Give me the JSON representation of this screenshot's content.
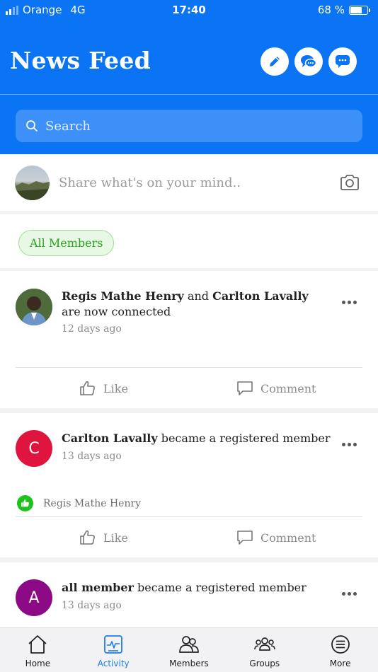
{
  "status_bar": {
    "carrier": "Orange",
    "network": "4G",
    "time": "17:40",
    "battery": "68 %"
  },
  "header": {
    "title": "News Feed",
    "buttons": [
      "edit-icon",
      "chat-bubbles-icon",
      "message-icon"
    ]
  },
  "search": {
    "placeholder": "Search"
  },
  "composer": {
    "placeholder": "Share what's on your mind.."
  },
  "filter": {
    "label": "All Members"
  },
  "posts": [
    {
      "actor": "Regis Mathe Henry",
      "joiner": "and",
      "actor2": "Carlton Lavally",
      "text": "are now connected",
      "time": "12 days ago",
      "avatar_letter": "",
      "avatar_color": "#3c5a2e",
      "like_label": "Like",
      "comment_label": "Comment"
    },
    {
      "actor": "Carlton Lavally",
      "text": "became a registered member",
      "time": "13 days ago",
      "avatar_letter": "C",
      "avatar_color": "#e0153e",
      "liked_by": "Regis Mathe Henry",
      "like_label": "Like",
      "comment_label": "Comment"
    },
    {
      "actor": "all member",
      "text": "became a registered member",
      "time": "13 days ago",
      "avatar_letter": "A",
      "avatar_color": "#8c0a85"
    }
  ],
  "tabs": [
    {
      "label": "Home",
      "icon": "home-icon"
    },
    {
      "label": "Activity",
      "icon": "activity-icon",
      "active": true
    },
    {
      "label": "Members",
      "icon": "members-icon"
    },
    {
      "label": "Groups",
      "icon": "groups-icon"
    },
    {
      "label": "More",
      "icon": "menu-icon"
    }
  ],
  "colors": {
    "brand": "#0a74f4",
    "accent_green": "#1ec11e",
    "active_tab": "#1a7bf0"
  }
}
